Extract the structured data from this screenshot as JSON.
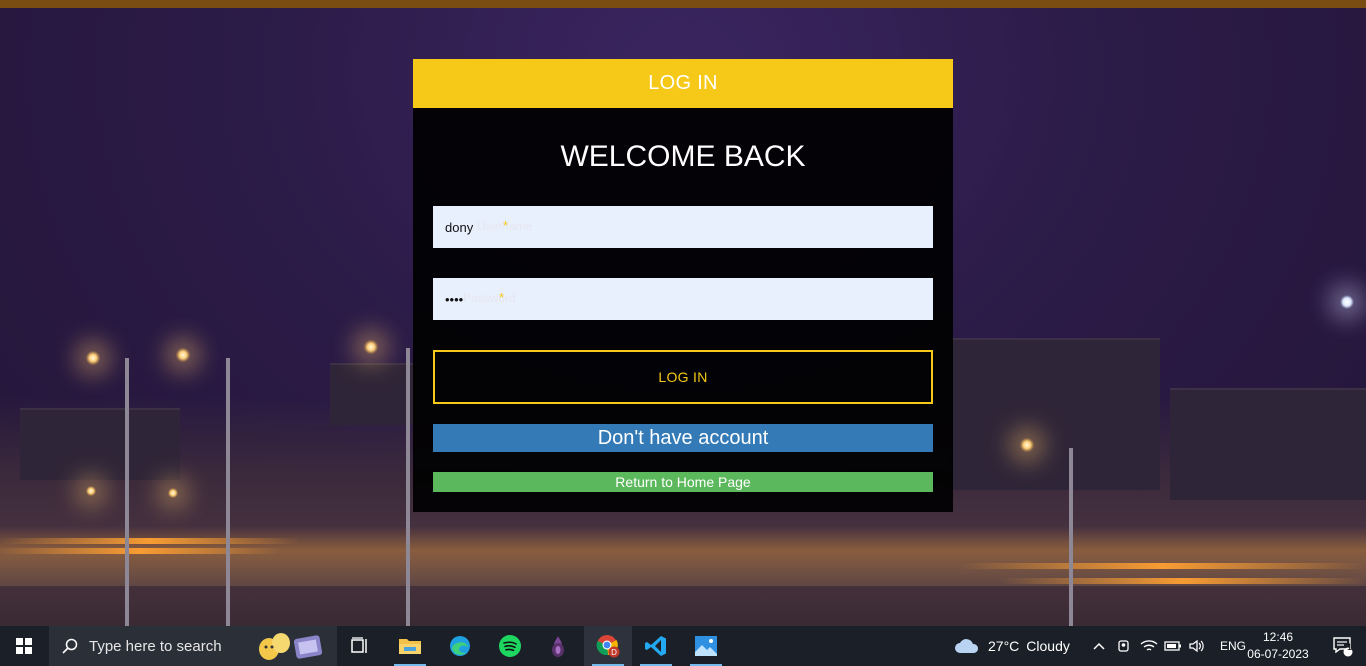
{
  "colors": {
    "accent_yellow": "#f6c918",
    "signup_blue": "#337ab7",
    "home_green": "#5cb85c",
    "card_bg": "#000000",
    "field_bg": "#e8f0fe",
    "taskbar_bg": "#1b1f27"
  },
  "login_card": {
    "header_title": "LOG IN",
    "welcome_heading": "WELCOME BACK",
    "username": {
      "value": "dony",
      "placeholder": "Username",
      "required_mark": "*"
    },
    "password": {
      "value": "dony",
      "placeholder": "Password",
      "required_mark": "*"
    },
    "login_button": "LOG IN",
    "signup_button": "Don't have account",
    "home_button": "Return to Home Page"
  },
  "taskbar": {
    "search_placeholder": "Type here to search",
    "pinned": [
      {
        "name": "task-view-icon"
      },
      {
        "name": "file-explorer-icon"
      },
      {
        "name": "edge-icon"
      },
      {
        "name": "spotify-icon"
      },
      {
        "name": "tor-browser-icon"
      },
      {
        "name": "chrome-icon"
      },
      {
        "name": "vscode-icon"
      },
      {
        "name": "photos-icon"
      }
    ],
    "weather": {
      "temp": "27°C",
      "condition": "Cloudy"
    },
    "language": "ENG",
    "time": "12:46",
    "date": "06-07-2023",
    "notification_count": "1"
  }
}
